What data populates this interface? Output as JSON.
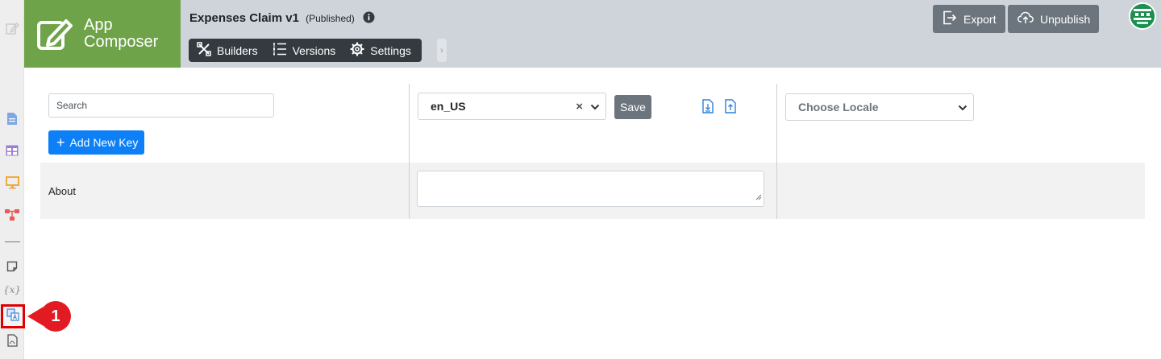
{
  "brand": {
    "line1": "App",
    "line2": "Composer"
  },
  "app": {
    "title": "Expenses Claim v1",
    "status": "(Published)"
  },
  "nav": {
    "builders": "Builders",
    "versions": "Versions",
    "settings": "Settings",
    "toggle": "›"
  },
  "header_buttons": {
    "export": "Export",
    "unpublish": "Unpublish"
  },
  "rail": {
    "variables_label": "{x}"
  },
  "callout": {
    "number": "1"
  },
  "search": {
    "placeholder": "Search"
  },
  "add_key": {
    "plus": "+",
    "label": "Add New Key"
  },
  "locale": {
    "selected": "en_US",
    "clear": "×",
    "save_label": "Save"
  },
  "target_locale": {
    "placeholder": "Choose Locale"
  },
  "rows": [
    {
      "key": "About",
      "value": ""
    }
  ],
  "colors": {
    "brand_green": "#6ea34a",
    "header_bg": "#ced4da",
    "nav_dark": "#343a40",
    "primary_blue": "#0d7ff7",
    "button_gray": "#6c757d",
    "callout_red": "#e21b23"
  },
  "icons": [
    "edit-icon",
    "document-icon",
    "table-icon",
    "monitor-icon",
    "workflow-icon",
    "note-icon",
    "translate-icon",
    "pdf-icon",
    "info-icon",
    "builders-icon",
    "versions-icon",
    "settings-icon",
    "export-icon",
    "cloud-upload-icon",
    "download-file-icon",
    "upload-file-icon"
  ]
}
